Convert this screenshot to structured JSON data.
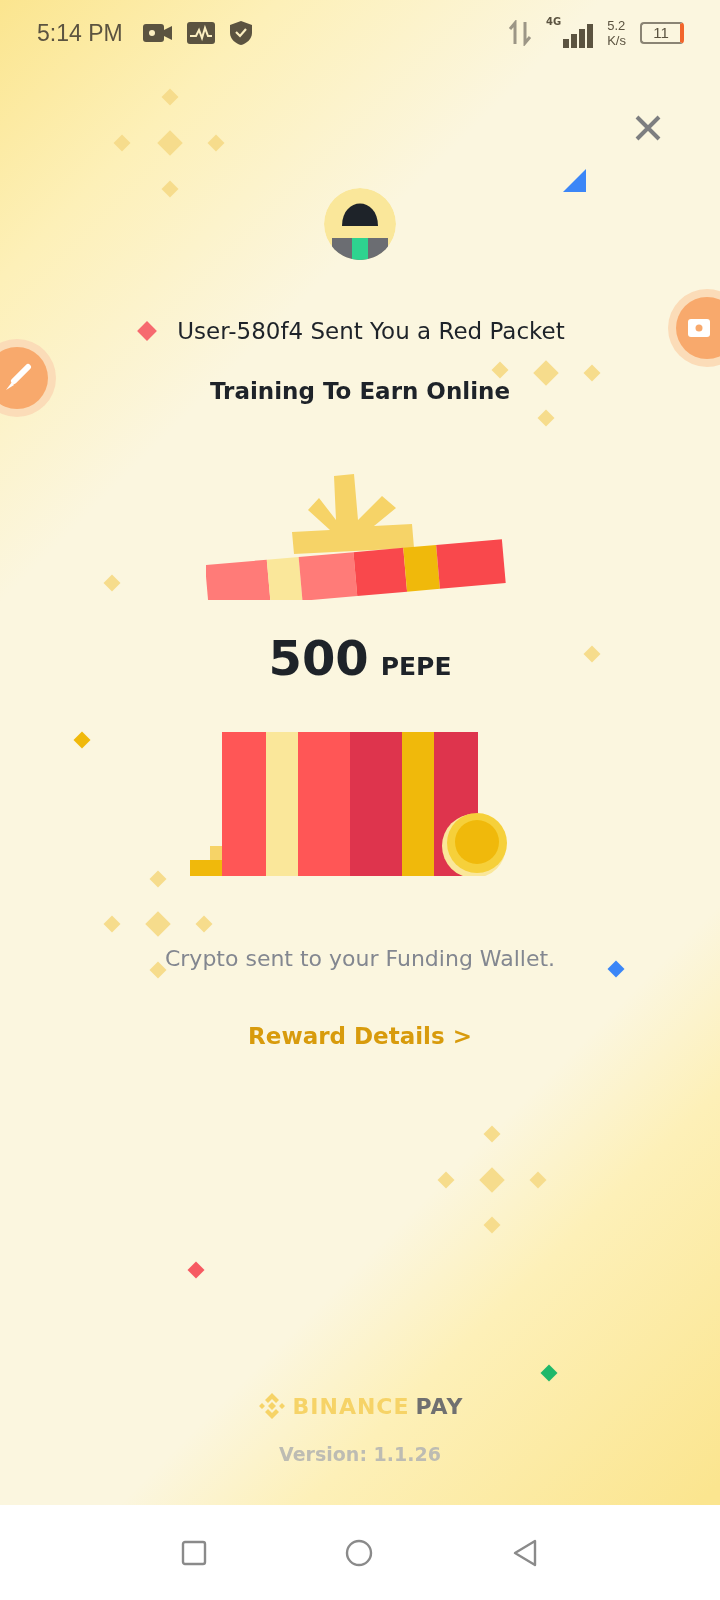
{
  "status_bar": {
    "time": "5:14 PM",
    "network": "4G",
    "speed": "5.2",
    "speed_unit": "K/s",
    "battery": "11"
  },
  "packet": {
    "sender_line": "User-580f4 Sent You a Red Packet",
    "title": "Training To Earn Online",
    "amount": "500",
    "currency": "PEPE",
    "note": "Crypto sent to your Funding Wallet.",
    "link": "Reward Details >"
  },
  "footer": {
    "brand": "BINANCE",
    "brand_suffix": "PAY",
    "version": "Version: 1.1.26"
  }
}
